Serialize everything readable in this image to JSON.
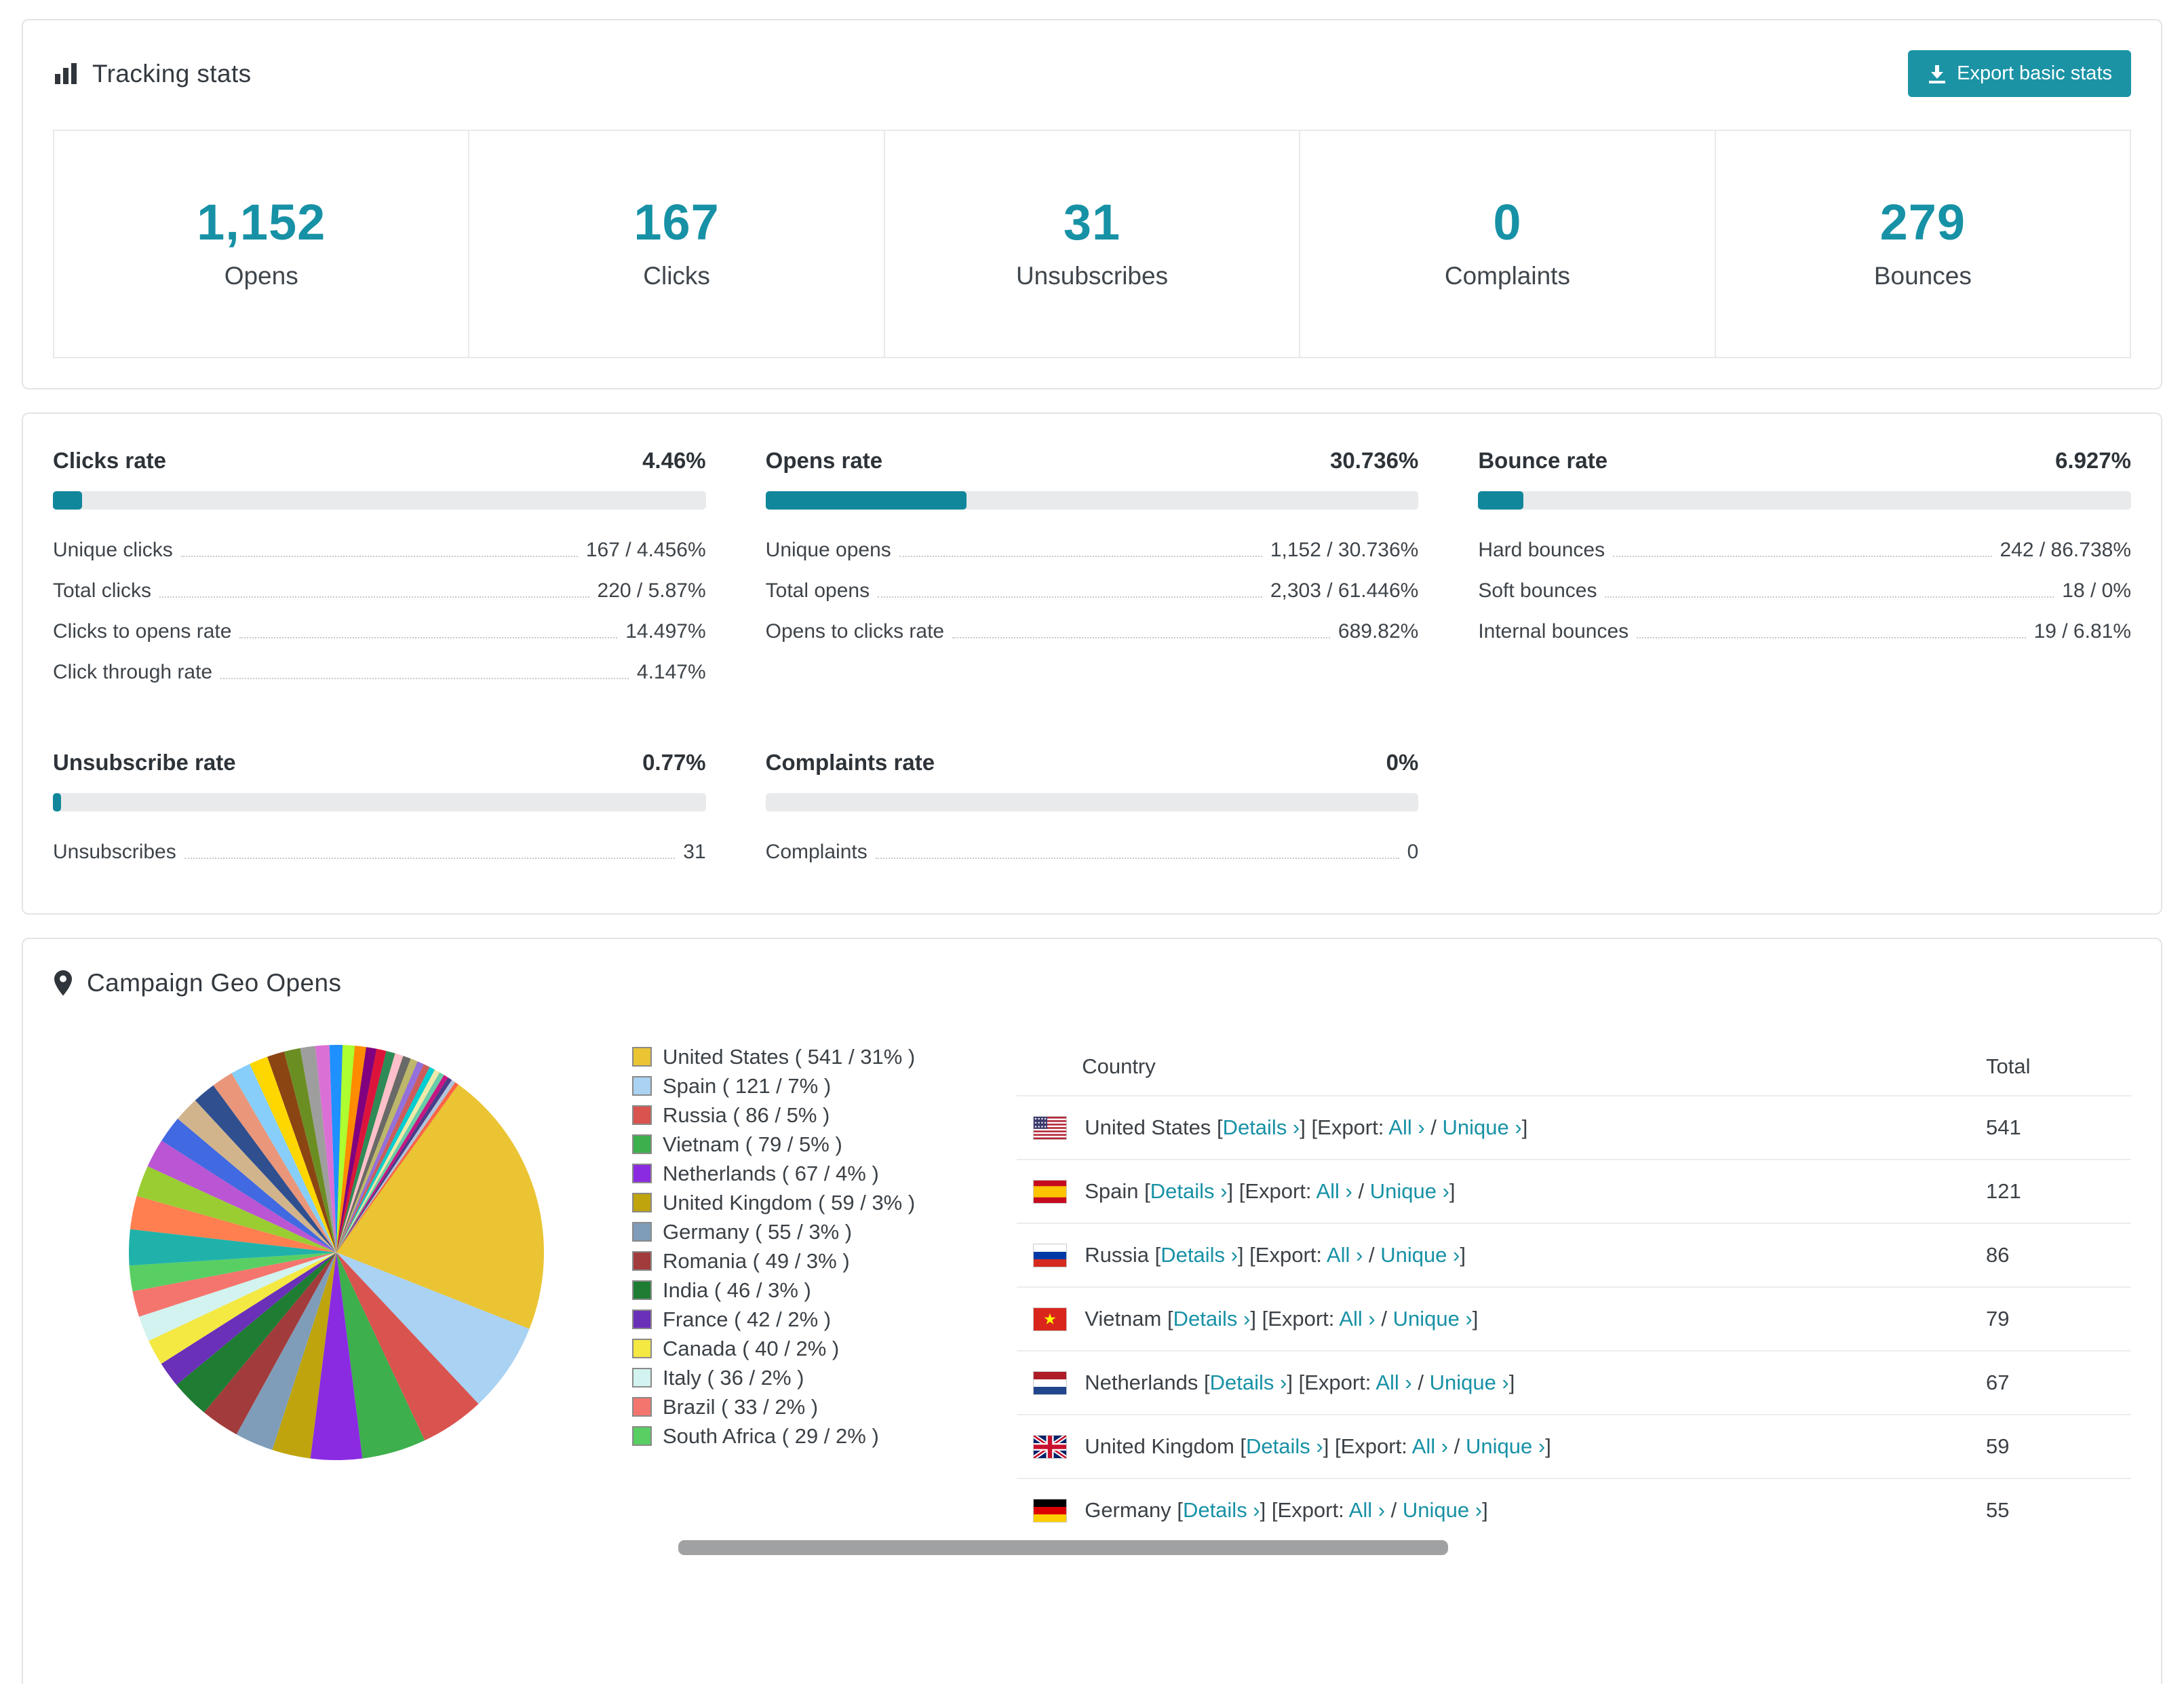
{
  "accent_color": "#1791a5",
  "bar_track_color": "#e9eaec",
  "tracking": {
    "title": "Tracking stats",
    "export_label": "Export basic stats",
    "stats": [
      {
        "value": "1,152",
        "label": "Opens"
      },
      {
        "value": "167",
        "label": "Clicks"
      },
      {
        "value": "31",
        "label": "Unsubscribes"
      },
      {
        "value": "0",
        "label": "Complaints"
      },
      {
        "value": "279",
        "label": "Bounces"
      }
    ]
  },
  "rates": [
    {
      "title": "Clicks rate",
      "percent": "4.46%",
      "bar": 4.46,
      "rows": [
        {
          "label": "Unique clicks",
          "value": "167 / 4.456%"
        },
        {
          "label": "Total clicks",
          "value": "220 / 5.87%"
        },
        {
          "label": "Clicks to opens rate",
          "value": "14.497%"
        },
        {
          "label": "Click through rate",
          "value": "4.147%"
        }
      ]
    },
    {
      "title": "Opens rate",
      "percent": "30.736%",
      "bar": 30.736,
      "rows": [
        {
          "label": "Unique opens",
          "value": "1,152 / 30.736%"
        },
        {
          "label": "Total opens",
          "value": "2,303 / 61.446%"
        },
        {
          "label": "Opens to clicks rate",
          "value": "689.82%"
        }
      ]
    },
    {
      "title": "Bounce rate",
      "percent": "6.927%",
      "bar": 6.927,
      "rows": [
        {
          "label": "Hard bounces",
          "value": "242 / 86.738%"
        },
        {
          "label": "Soft bounces",
          "value": "18 / 0%"
        },
        {
          "label": "Internal bounces",
          "value": "19 / 6.81%"
        }
      ]
    },
    {
      "title": "Unsubscribe rate",
      "percent": "0.77%",
      "bar": 0.77,
      "rows": [
        {
          "label": "Unsubscribes",
          "value": "31"
        }
      ]
    },
    {
      "title": "Complaints rate",
      "percent": "0%",
      "bar": 0,
      "rows": [
        {
          "label": "Complaints",
          "value": "0"
        }
      ]
    }
  ],
  "geo": {
    "title": "Campaign Geo Opens",
    "table": {
      "country_header": "Country",
      "total_header": "Total",
      "details_label": "Details ›",
      "export_label": "Export:",
      "all_label": "All ›",
      "slash": "/",
      "unique_label": "Unique ›"
    },
    "rows": [
      {
        "country": "United States",
        "total": 541,
        "flag": "us"
      },
      {
        "country": "Spain",
        "total": 121,
        "flag": "es"
      },
      {
        "country": "Russia",
        "total": 86,
        "flag": "ru"
      },
      {
        "country": "Vietnam",
        "total": 79,
        "flag": "vn"
      },
      {
        "country": "Netherlands",
        "total": 67,
        "flag": "nl"
      },
      {
        "country": "United Kingdom",
        "total": 59,
        "flag": "gb"
      },
      {
        "country": "Germany",
        "total": 55,
        "flag": "de"
      }
    ]
  },
  "chart_data": {
    "type": "pie",
    "title": "Campaign Geo Opens",
    "legend_position": "right",
    "slices": [
      {
        "label": "United States",
        "count": 541,
        "percent": 31,
        "color": "#eac433"
      },
      {
        "label": "Spain",
        "count": 121,
        "percent": 7,
        "color": "#a9d2f3"
      },
      {
        "label": "Russia",
        "count": 86,
        "percent": 5,
        "color": "#d9534f"
      },
      {
        "label": "Vietnam",
        "count": 79,
        "percent": 5,
        "color": "#3daf4c"
      },
      {
        "label": "Netherlands",
        "count": 67,
        "percent": 4,
        "color": "#8a2be2"
      },
      {
        "label": "United Kingdom",
        "count": 59,
        "percent": 3,
        "color": "#bfa40e"
      },
      {
        "label": "Germany",
        "count": 55,
        "percent": 3,
        "color": "#7f9db9"
      },
      {
        "label": "Romania",
        "count": 49,
        "percent": 3,
        "color": "#a23b3b"
      },
      {
        "label": "India",
        "count": 46,
        "percent": 3,
        "color": "#1e7d32"
      },
      {
        "label": "France",
        "count": 42,
        "percent": 2,
        "color": "#6a30b8"
      },
      {
        "label": "Canada",
        "count": 40,
        "percent": 2,
        "color": "#f4e842"
      },
      {
        "label": "Italy",
        "count": 36,
        "percent": 2,
        "color": "#d2f3ef"
      },
      {
        "label": "Brazil",
        "count": 33,
        "percent": 2,
        "color": "#f4756d"
      },
      {
        "label": "South Africa",
        "count": 29,
        "percent": 2,
        "color": "#59cf63"
      }
    ],
    "other_slices_percent": 36,
    "other_slice_colors": [
      "#20b2aa",
      "#ff7f50",
      "#9acd32",
      "#ba55d3",
      "#4169e1",
      "#d2b48c",
      "#2f4f8f",
      "#e9967a",
      "#87cefa",
      "#ffd700",
      "#8b4513",
      "#6b8e23",
      "#9e9e9e",
      "#da70d6",
      "#1e90ff",
      "#adff2f",
      "#ff8c00",
      "#800080",
      "#dc143c",
      "#2e8b57",
      "#ffc0cb",
      "#696969",
      "#bdb76b",
      "#9370db",
      "#cd5c5c",
      "#00ced1",
      "#eee8aa",
      "#66cdaa",
      "#c71585",
      "#483d8b",
      "#b0c4de",
      "#ff6347"
    ]
  }
}
